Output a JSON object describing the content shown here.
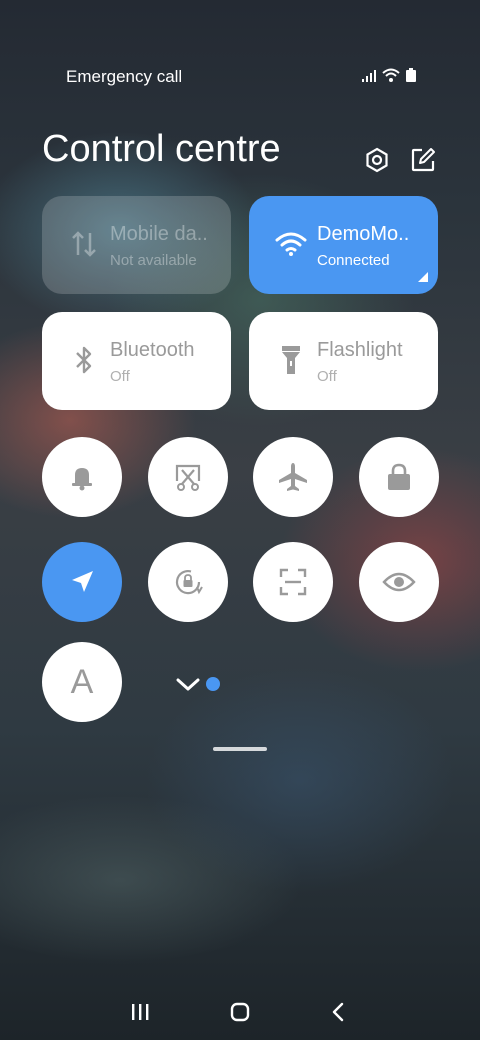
{
  "status": {
    "carrier": "Emergency call"
  },
  "header": {
    "title": "Control centre"
  },
  "tiles": [
    {
      "title": "Mobile da..",
      "subtitle": "Not available",
      "state": "disabled",
      "icon": "mobile-data-icon"
    },
    {
      "title": "DemoMo..",
      "subtitle": "Connected",
      "state": "active",
      "icon": "wifi-icon"
    },
    {
      "title": "Bluetooth",
      "subtitle": "Off",
      "state": "off",
      "icon": "bluetooth-icon"
    },
    {
      "title": "Flashlight",
      "subtitle": "Off",
      "state": "off",
      "icon": "flashlight-icon"
    }
  ],
  "toggles": [
    {
      "icon": "bell-icon",
      "active": false
    },
    {
      "icon": "screenshot-icon",
      "active": false
    },
    {
      "icon": "airplane-icon",
      "active": false
    },
    {
      "icon": "lock-icon",
      "active": false
    },
    {
      "icon": "location-icon",
      "active": true
    },
    {
      "icon": "rotation-lock-icon",
      "active": false
    },
    {
      "icon": "scanner-icon",
      "active": false
    },
    {
      "icon": "eye-icon",
      "active": false
    },
    {
      "icon": "font-size-icon",
      "label": "A",
      "active": false
    }
  ],
  "colors": {
    "accent": "#4a97f2",
    "tile": "#ffffff",
    "icon_grey": "#9a9a9a"
  }
}
